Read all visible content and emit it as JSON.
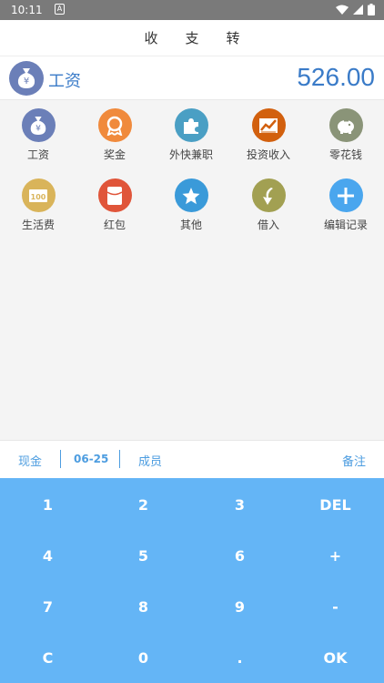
{
  "status_bar": {
    "time": "10:11",
    "notif_letter": "A"
  },
  "tabs": [
    {
      "label": "收",
      "active": true
    },
    {
      "label": "支",
      "active": false
    },
    {
      "label": "转",
      "active": false
    }
  ],
  "selected": {
    "icon": "money-bag-icon",
    "name": "工资",
    "amount": "526.00"
  },
  "categories": [
    {
      "label": "工资",
      "icon": "money-bag-icon",
      "color": "#6b7fb8"
    },
    {
      "label": "奖金",
      "icon": "medal-icon",
      "color": "#f08a3c"
    },
    {
      "label": "外快兼职",
      "icon": "puzzle-icon",
      "color": "#4a9fc4"
    },
    {
      "label": "投资收入",
      "icon": "trend-chart-icon",
      "color": "#d2600e"
    },
    {
      "label": "零花钱",
      "icon": "piggy-bank-icon",
      "color": "#8a9478"
    },
    {
      "label": "生活费",
      "icon": "banknote-icon",
      "color": "#d9b45a"
    },
    {
      "label": "红包",
      "icon": "red-envelope-icon",
      "color": "#e0553a"
    },
    {
      "label": "其他",
      "icon": "star-icon",
      "color": "#3a9ad9"
    },
    {
      "label": "借入",
      "icon": "arrow-down-icon",
      "color": "#a2a052"
    },
    {
      "label": "编辑记录",
      "icon": "plus-icon",
      "color": "#4aa6ee"
    }
  ],
  "banknote_text": "100",
  "info": {
    "account": "现金",
    "date": "06-25",
    "member": "成员",
    "note": "备注"
  },
  "keys": [
    "1",
    "2",
    "3",
    "DEL",
    "4",
    "5",
    "6",
    "+",
    "7",
    "8",
    "9",
    "-",
    "C",
    "0",
    ".",
    "OK"
  ]
}
